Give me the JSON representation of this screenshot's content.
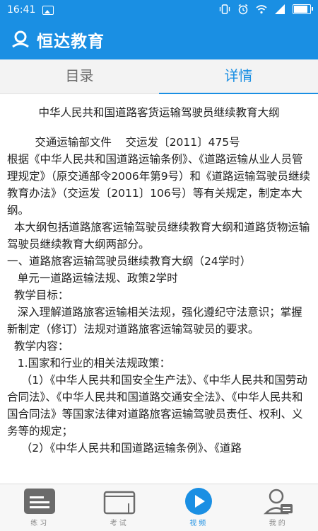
{
  "status_bar": {
    "time": "16:41",
    "icons": [
      "image-icon",
      "vibrate-icon",
      "alarm-icon",
      "wifi-icon",
      "signal-icon",
      "battery-icon"
    ]
  },
  "app": {
    "title": "恒达教育",
    "brand_color": "#1a8fe3"
  },
  "tabs": [
    {
      "label": "目录",
      "active": false
    },
    {
      "label": "详情",
      "active": true
    }
  ],
  "document": {
    "title": "中华人民共和国道路客货运输驾驶员继续教育大纲",
    "paragraphs": [
      "        交通运输部文件    交运发〔2011〕475号",
      "根据《中华人民共和国道路运输条例》、《道路运输从业人员管理规定》（原交通部令2006年第9号）和《道路运输驾驶员继续教育办法》（交运发〔2011〕106号）等有关规定，制定本大纲。",
      "  本大纲包括道路旅客运输驾驶员继续教育大纲和道路货物运输驾驶员继续教育大纲两部分。",
      "一、道路旅客运输驾驶员继续教育大纲（24学时）",
      "   单元一道路运输法规、政策2学时",
      "  教学目标：",
      "   深入理解道路旅客运输相关法规，强化遵纪守法意识；掌握新制定（修订）法规对道路旅客运输驾驶员的要求。",
      "  教学内容：",
      "   1.国家和行业的相关法规政策：",
      "    （1）《中华人民共和国安全生产法》、《中华人民共和国劳动合同法》、《中华人民共和国道路交通安全法》、《中华人民共和国合同法》等国家法律对道路旅客运输驾驶员责任、权利、义务等的规定；",
      "    （2）《中华人民共和国道路运输条例》、《道路"
    ]
  },
  "bottom_nav": [
    {
      "label": "练习",
      "icon": "practice-icon",
      "active": false
    },
    {
      "label": "考试",
      "icon": "exam-icon",
      "active": false
    },
    {
      "label": "视频",
      "icon": "video-play-icon",
      "active": true
    },
    {
      "label": "我的",
      "icon": "profile-icon",
      "active": false
    }
  ]
}
